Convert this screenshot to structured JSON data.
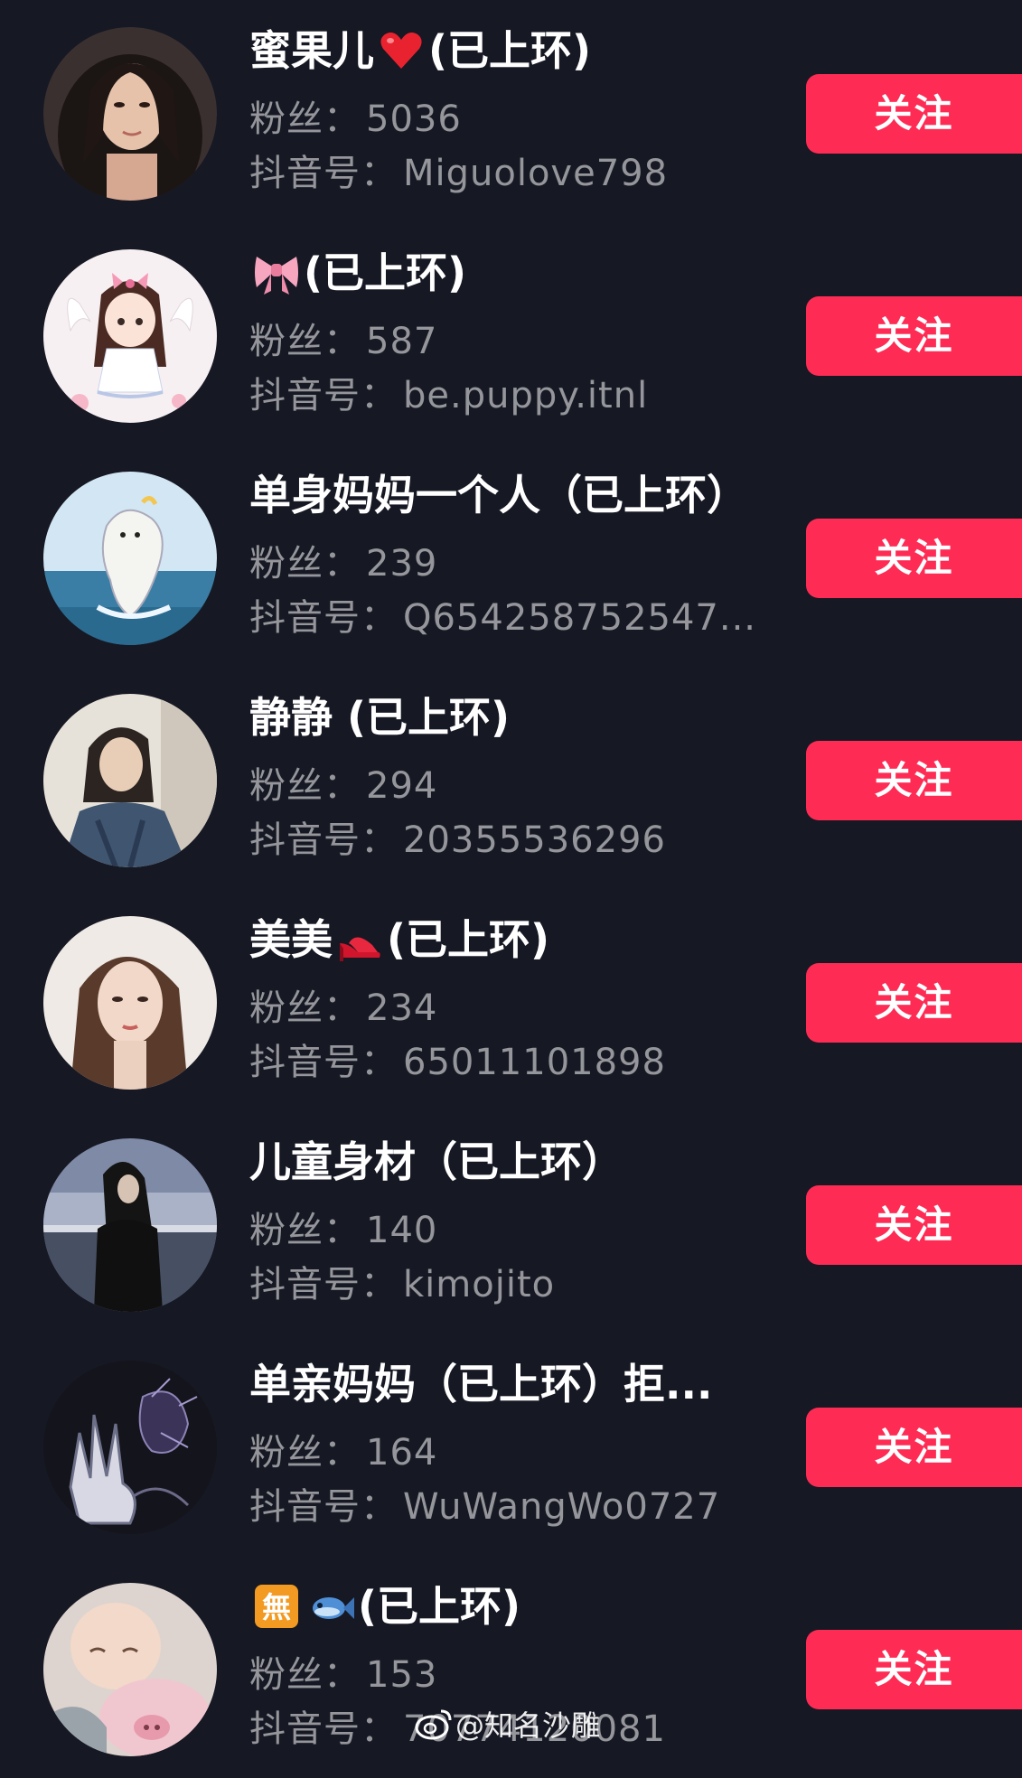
{
  "labels": {
    "fans_prefix": "粉丝：",
    "douyin_id_prefix": "抖音号：",
    "follow_button": "关注"
  },
  "colors": {
    "background": "#161823",
    "follow_button": "#fe2c55",
    "secondary_text": "rgba(255,255,255,0.55)"
  },
  "users": [
    {
      "name_pre": "蜜果儿",
      "emoji": "heart-emoji",
      "name_post": "(已上环)",
      "fans": "5036",
      "douyin_id": "Miguolove798",
      "avatar": "portrait-woman-long-hair"
    },
    {
      "name_pre": "",
      "emoji": "bow-emoji",
      "name_post": "(已上环)",
      "fans": "587",
      "douyin_id": "be.puppy.itnl",
      "avatar": "anime-girl-pink-bow"
    },
    {
      "name_pre": "单身妈妈一个人（已上环）",
      "emoji": "",
      "name_post": "",
      "fans": "239",
      "douyin_id": "Q654258752547...",
      "avatar": "cartoon-bird-sea"
    },
    {
      "name_pre": "静静 (已上环)",
      "emoji": "",
      "name_post": "",
      "fans": "294",
      "douyin_id": "20355536296",
      "avatar": "portrait-woman-denim"
    },
    {
      "name_pre": "美美",
      "emoji": "high-heel-emoji",
      "name_post": "(已上环)",
      "fans": "234",
      "douyin_id": "65011101898",
      "avatar": "portrait-woman-wavy-hair"
    },
    {
      "name_pre": "儿童身材（已上环）",
      "emoji": "",
      "name_post": "",
      "fans": "140",
      "douyin_id": "kimojito",
      "avatar": "woman-black-outfit-bridge"
    },
    {
      "name_pre": "单亲妈妈（已上环）拒...",
      "emoji": "",
      "name_post": "",
      "fans": "164",
      "douyin_id": "WuWangWo0727",
      "avatar": "dark-sketch-hand"
    },
    {
      "name_pre": "",
      "emoji": "wu-fish-emoji",
      "name_post": "(已上环)",
      "fans": "153",
      "douyin_id": "70774120081",
      "avatar": "sleeping-baby-pig"
    }
  ],
  "watermark": {
    "text": "@知名沙雕",
    "icon": "weibo-logo"
  }
}
